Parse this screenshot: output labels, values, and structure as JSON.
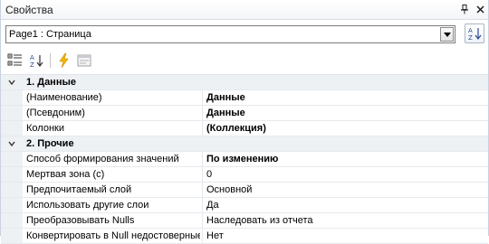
{
  "window": {
    "title": "Свойства",
    "pin_icon": "pin-icon",
    "close_icon": "close-icon"
  },
  "selector": {
    "value": "Page1 : Страница"
  },
  "toolbar": {
    "buttons": [
      "categorized-view-icon",
      "alphabetical-sort-icon",
      "events-lightning-icon",
      "property-pages-icon"
    ]
  },
  "grid": {
    "categories": [
      {
        "label": "1. Данные",
        "properties": [
          {
            "name": "(Наименование)",
            "value": "Данные",
            "bold": true
          },
          {
            "name": "(Псевдоним)",
            "value": "Данные",
            "bold": true
          },
          {
            "name": "Колонки",
            "value": "(Коллекция)",
            "bold": true
          }
        ]
      },
      {
        "label": "2. Прочие",
        "properties": [
          {
            "name": "Способ формирования значений",
            "value": "По изменению",
            "bold": true
          },
          {
            "name": "Мертвая зона (с)",
            "value": "0",
            "bold": false
          },
          {
            "name": "Предпочитаемый слой",
            "value": "Основной",
            "bold": false
          },
          {
            "name": "Использовать другие слои",
            "value": "Да",
            "bold": false
          },
          {
            "name": "Преобразовывать Nulls",
            "value": "Наследовать из отчета",
            "bold": false
          },
          {
            "name": "Конвертировать в Null недостоверные",
            "value": "Нет",
            "bold": false
          }
        ]
      }
    ]
  },
  "colors": {
    "category_background": "#eef1f4",
    "grid_line": "#e6e9ed",
    "border": "#c9d2dd",
    "lightning": "#f5b400"
  }
}
